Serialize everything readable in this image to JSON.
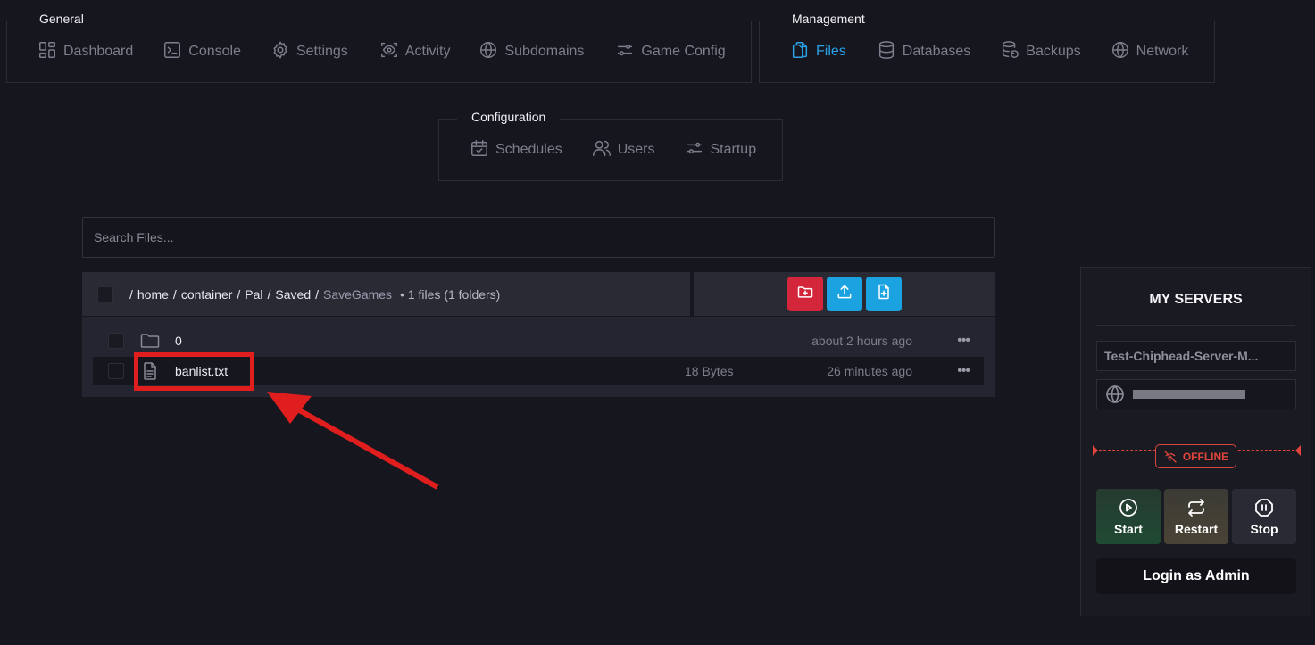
{
  "nav": {
    "general": {
      "legend": "General",
      "items": [
        "Dashboard",
        "Console",
        "Settings",
        "Activity",
        "Subdomains",
        "Game Config"
      ]
    },
    "management": {
      "legend": "Management",
      "items": [
        "Files",
        "Databases",
        "Backups",
        "Network"
      ],
      "active": "Files"
    },
    "configuration": {
      "legend": "Configuration",
      "items": [
        "Schedules",
        "Users",
        "Startup"
      ]
    }
  },
  "search": {
    "placeholder": "Search Files..."
  },
  "breadcrumb": {
    "parts": [
      "/",
      "home",
      "/",
      "container",
      "/",
      "Pal",
      "/",
      "Saved",
      "/",
      "SaveGames"
    ],
    "summary": "• 1 files (1 folders)"
  },
  "files": [
    {
      "name": "0",
      "type": "folder",
      "size": "",
      "modified": "about 2 hours ago",
      "more": "•••"
    },
    {
      "name": "banlist.txt",
      "type": "file",
      "size": "18 Bytes",
      "modified": "26 minutes ago",
      "more": "•••"
    }
  ],
  "sidebar": {
    "title": "MY SERVERS",
    "server_name": "Test-Chiphead-Server-M...",
    "status": "OFFLINE",
    "buttons": {
      "start": "Start",
      "restart": "Restart",
      "stop": "Stop"
    },
    "login": "Login as Admin"
  },
  "colors": {
    "background": "#16161f",
    "accent": "#2aa0e6",
    "offline": "#e0443a",
    "new_folder_button": "#d4263a",
    "upload_button": "#1aa3e0",
    "annotation": "#e01e1e"
  }
}
